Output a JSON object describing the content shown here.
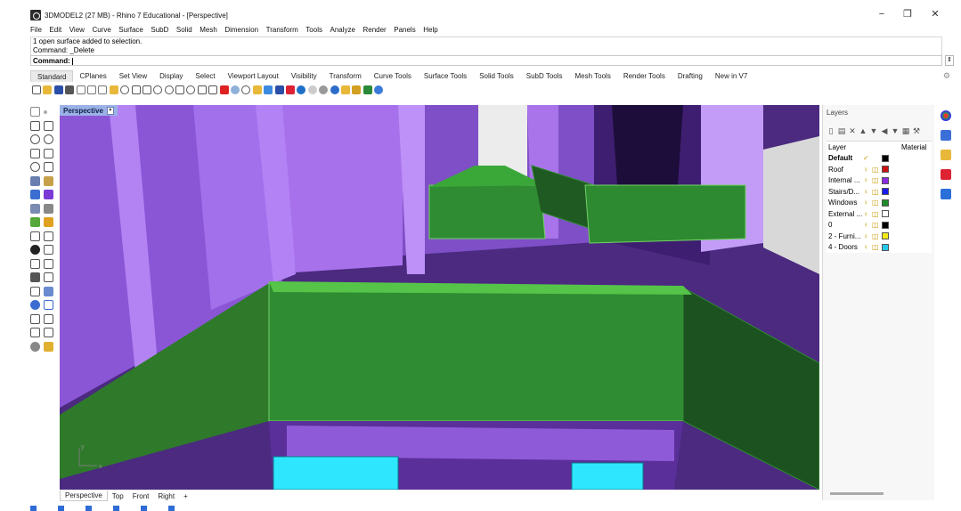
{
  "window": {
    "title": "3DMODEL2 (27 MB) - Rhino 7 Educational - [Perspective]",
    "minimize": "−",
    "restore": "❐",
    "close": "✕"
  },
  "menu": [
    "File",
    "Edit",
    "View",
    "Curve",
    "Surface",
    "SubD",
    "Solid",
    "Mesh",
    "Dimension",
    "Transform",
    "Tools",
    "Analyze",
    "Render",
    "Panels",
    "Help"
  ],
  "command": {
    "history": [
      "1 open surface added to selection.",
      "Command: _Delete"
    ],
    "prompt": "Command:"
  },
  "toolbar_tabs": [
    "Standard",
    "CPlanes",
    "Set View",
    "Display",
    "Select",
    "Viewport Layout",
    "Visibility",
    "Transform",
    "Curve Tools",
    "Surface Tools",
    "Solid Tools",
    "SubD Tools",
    "Mesh Tools",
    "Render Tools",
    "Drafting",
    "New in V7"
  ],
  "viewport": {
    "label": "Perspective",
    "tabs": [
      "Perspective",
      "Top",
      "Front",
      "Right",
      "+"
    ],
    "axis_y": "y",
    "axis_x": "x"
  },
  "layers": {
    "panel_title": "Layers",
    "header_layer": "Layer",
    "header_material": "Material",
    "rows": [
      {
        "name": "Default",
        "current": "✓",
        "color": "#000000"
      },
      {
        "name": "Roof",
        "color": "#cc1111"
      },
      {
        "name": "Internal ...",
        "color": "#8a2be2"
      },
      {
        "name": "Stairs/D...",
        "color": "#1a1aee"
      },
      {
        "name": "Windows",
        "color": "#1f8a2a"
      },
      {
        "name": "External ...",
        "color": "#ffffff"
      },
      {
        "name": "0",
        "color": "#000000"
      },
      {
        "name": "2 - Furni...",
        "color": "#f2ea13"
      },
      {
        "name": "4 - Doors",
        "color": "#27c8e8"
      }
    ]
  },
  "icons": {
    "app": "rhino-app-icon",
    "gear": "gear-icon",
    "layer_visible": "lightbulb-icon",
    "layer_lock": "lock-icon"
  },
  "colors": {
    "wall_purple": "#a66cf0",
    "floor_purple": "#4b2a80",
    "wall_green": "#2f8c32",
    "furniture_cyan": "#2ee7ff"
  }
}
